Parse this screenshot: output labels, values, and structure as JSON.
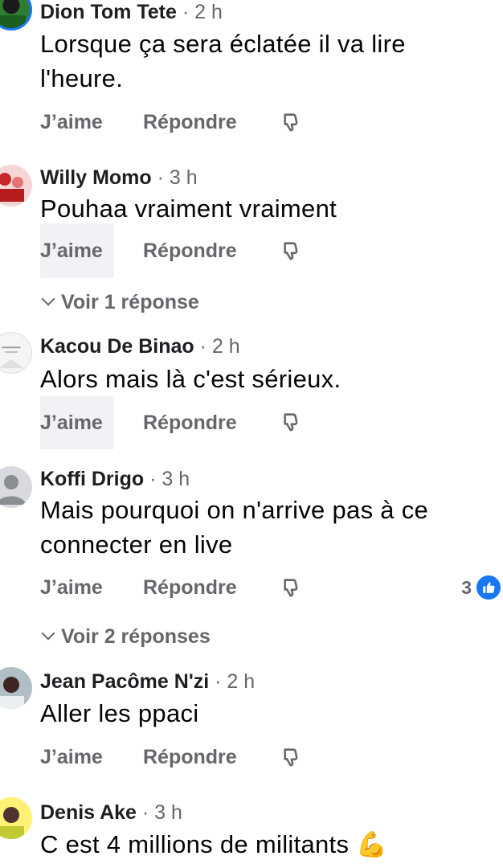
{
  "comments": [
    {
      "name": "Dion Tom Tete",
      "time": " · 2 h",
      "text": "Lorsque ça sera éclatée il va lire l'heure.",
      "like_label": "J’aime",
      "reply_label": "Répondre"
    },
    {
      "name": "Willy Momo",
      "time": " · 3 h",
      "text": "Pouhaa vraiment vraiment",
      "like_label": "J’aime",
      "reply_label": "Répondre",
      "replies_label": "Voir 1 réponse"
    },
    {
      "name": "Kacou De Binao",
      "time": " · 2 h",
      "text": "Alors mais là c'est sérieux.",
      "like_label": "J’aime",
      "reply_label": "Répondre"
    },
    {
      "name": "Koffi Drigo",
      "time": " · 3 h",
      "text": "Mais pourquoi on n'arrive  pas à ce connecter en live",
      "like_label": "J’aime",
      "reply_label": "Répondre",
      "reaction_count": "3",
      "replies_label": "Voir 2 réponses"
    },
    {
      "name": "Jean Pacôme N'zi",
      "time": " · 2 h",
      "text": "Aller les ppaci",
      "like_label": "J’aime",
      "reply_label": "Répondre"
    },
    {
      "name": "Denis Ake",
      "time": " · 3 h",
      "text": "C est 4 millions de militants 💪"
    }
  ],
  "colors": {
    "secondary_text": "#65676b",
    "reaction_blue": "#1877f2"
  },
  "icons": {
    "dislike": "thumbs-down-icon",
    "reaction": "like-reaction-icon",
    "expand": "chevron-down-icon"
  }
}
